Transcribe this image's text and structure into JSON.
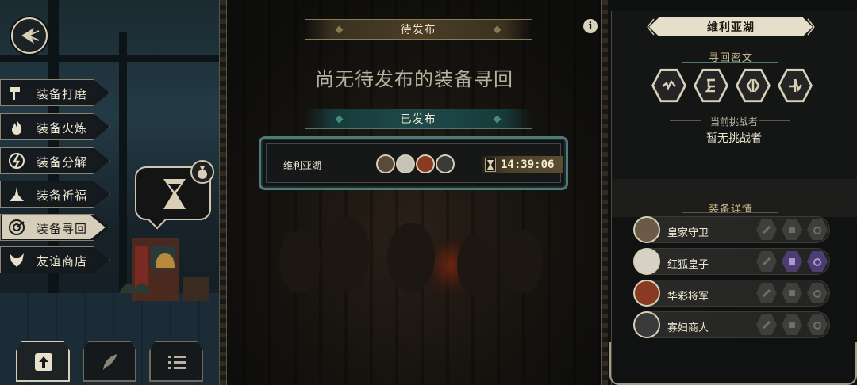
{
  "left": {
    "menu": [
      {
        "label": "装备打磨",
        "icon": "hammer-icon"
      },
      {
        "label": "装备火炼",
        "icon": "flame-icon"
      },
      {
        "label": "装备分解",
        "icon": "disassemble-icon"
      },
      {
        "label": "装备祈福",
        "icon": "prayer-icon"
      },
      {
        "label": "装备寻回",
        "icon": "retrieve-icon",
        "active": true
      },
      {
        "label": "友谊商店",
        "icon": "fox-icon"
      }
    ],
    "bottom_buttons": [
      "upload-icon",
      "feather-icon",
      "list-icon"
    ]
  },
  "middle": {
    "pending_title": "待发布",
    "empty_message": "尚无待发布的装备寻回",
    "published_title": "已发布",
    "entry": {
      "name": "维利亚湖",
      "timer": "14:39:06"
    }
  },
  "right": {
    "location": "维利亚湖",
    "cipher_title": "寻回密文",
    "challenger_label": "当前挑战者",
    "challenger_value": "暂无挑战者",
    "equipment_title": "装备详情",
    "equipment": [
      {
        "name": "皇家守卫"
      },
      {
        "name": "红狐皇子"
      },
      {
        "name": "华彩将军"
      },
      {
        "name": "寡妇商人"
      }
    ]
  },
  "colors": {
    "accent": "#d8cfb6",
    "teal": "#4f7a78",
    "gold": "#8a7a52",
    "purple": "#4c3f70"
  }
}
